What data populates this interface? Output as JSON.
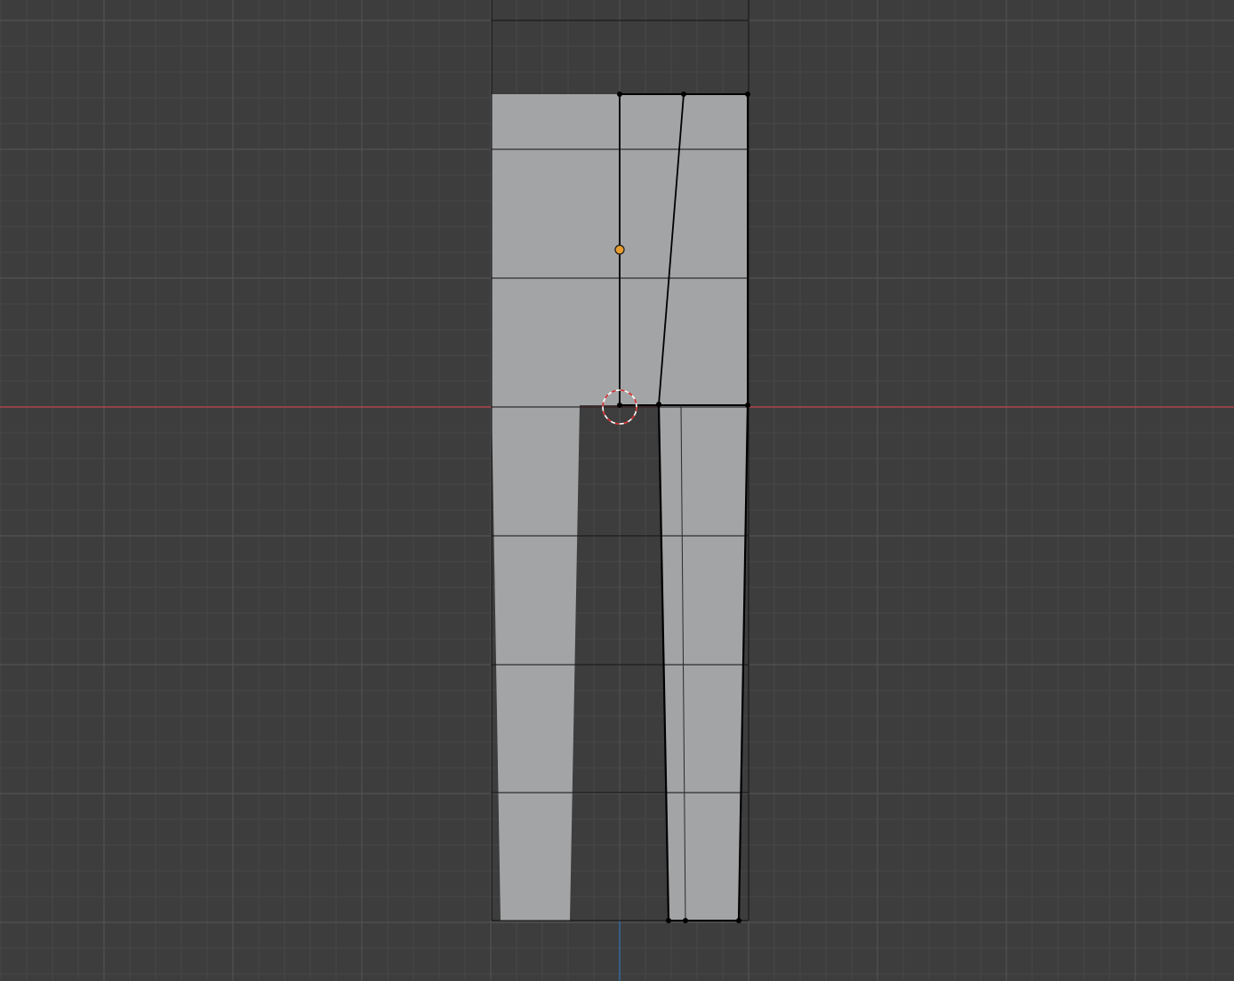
{
  "viewport": {
    "view": "front-orthographic",
    "mode": "edit",
    "background_color": "#3d3d3d",
    "grid": {
      "minor_color": "#474747",
      "major_color": "#525252"
    },
    "axes": {
      "x_axis_color": "#c1434b",
      "z_axis_color": "#2e6fb5"
    }
  },
  "mesh": {
    "name": "trouser-mesh",
    "face_color": "#a3a4a6",
    "wire_color": "#111111",
    "selected_edge_color": "#000000",
    "vertex_color": "#000000",
    "origin_color": "#e59b2f",
    "cursor_colors": [
      "#ffffff",
      "#d42a2a"
    ]
  }
}
